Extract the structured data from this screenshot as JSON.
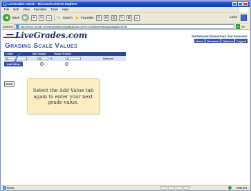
{
  "window": {
    "title": "LiveGrades Admin - Microsoft Internet Explorer"
  },
  "menu": [
    "File",
    "Edit",
    "View",
    "Favorites",
    "Tools",
    "Help"
  ],
  "toolbar": {
    "back_label": "Back",
    "search_label": "Search",
    "favorites_label": "Favorites",
    "links_label": "Links"
  },
  "address": {
    "label": "Address",
    "url": "http://demo1.cbcmsh.net/onlinegradebook/gradingScales.cfm?uro=edit&tableValue&grading&id=40289",
    "go_label": "Go"
  },
  "site": {
    "logo_text": "LiveGrades.com",
    "school_name": "Northbrook Elementary  2nd Semester",
    "nav": [
      "Home",
      "Semester",
      "Options",
      "Logout"
    ]
  },
  "page": {
    "heading": "Grading Scale Values",
    "columns": [
      "Letter",
      "Min Grade",
      "Grade Points"
    ],
    "row": {
      "letter": "A",
      "min_grade": "90",
      "pct": "%",
      "grade_points": "4",
      "remove_label": "Remove"
    },
    "add_value_label": "Add Value",
    "save_label": "Save"
  },
  "callout": {
    "lines": [
      "Select the Add Value tab",
      "again to enter your next",
      "grade value."
    ]
  },
  "status": {
    "text": "Done",
    "zone": "Internet"
  }
}
